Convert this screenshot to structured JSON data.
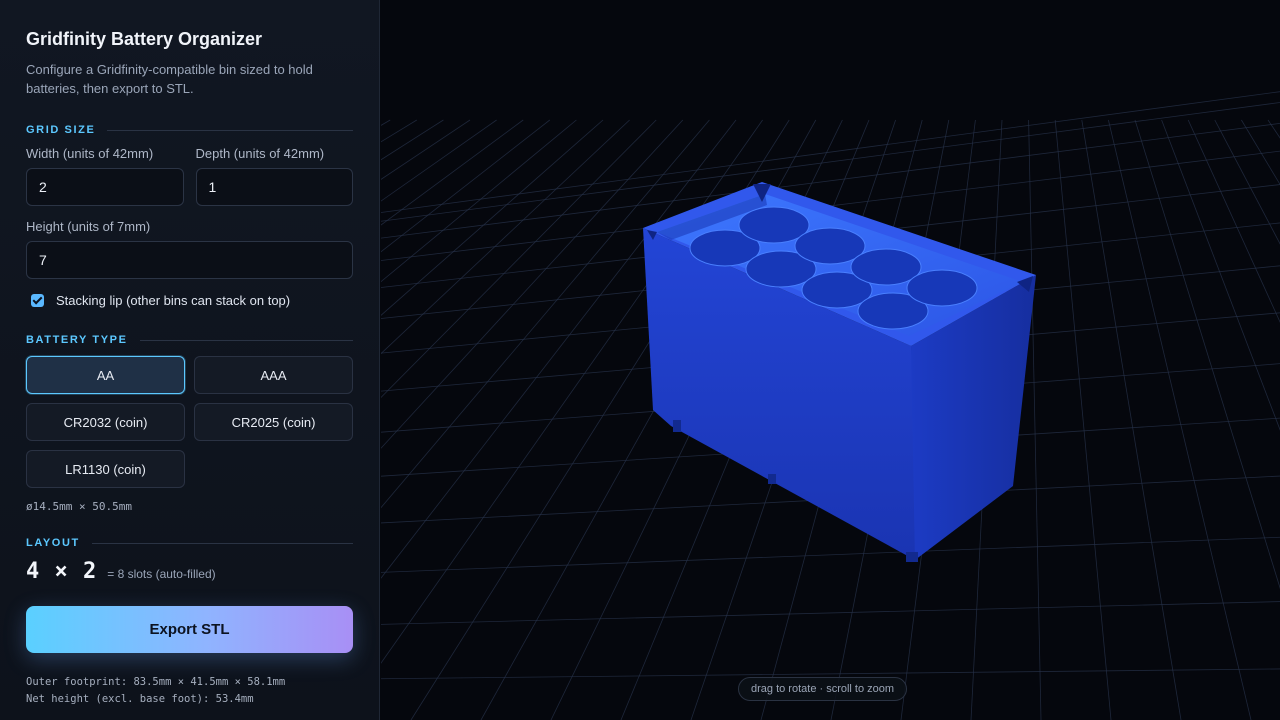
{
  "app": {
    "title": "Gridfinity Battery Organizer",
    "description": "Configure a Gridfinity-compatible bin sized to hold batteries, then export to STL."
  },
  "grid_size": {
    "section_label": "GRID SIZE",
    "width_label": "Width (units of 42mm)",
    "width_value": "2",
    "depth_label": "Depth (units of 42mm)",
    "depth_value": "1",
    "height_label": "Height (units of 7mm)",
    "height_value": "7",
    "stacking_lip_label": "Stacking lip (other bins can stack on top)",
    "stacking_lip_checked": true
  },
  "battery_type": {
    "section_label": "BATTERY TYPE",
    "options": [
      "AA",
      "AAA",
      "CR2032 (coin)",
      "CR2025 (coin)",
      "LR1130 (coin)"
    ],
    "selected": "AA",
    "dimensions": "ø14.5mm × 50.5mm"
  },
  "layout": {
    "section_label": "LAYOUT",
    "grid": "4 × 2",
    "note": "= 8 slots (auto-filled)"
  },
  "export": {
    "button_label": "Export STL",
    "outer_footprint": "Outer footprint: 83.5mm × 41.5mm × 58.1mm",
    "net_height": "Net height (excl. base foot): 53.4mm"
  },
  "viewport": {
    "hint": "drag to rotate · scroll to zoom"
  },
  "colors": {
    "accent": "#5cc8ff",
    "bin": "#1f3fcf",
    "background": "#05070d"
  }
}
